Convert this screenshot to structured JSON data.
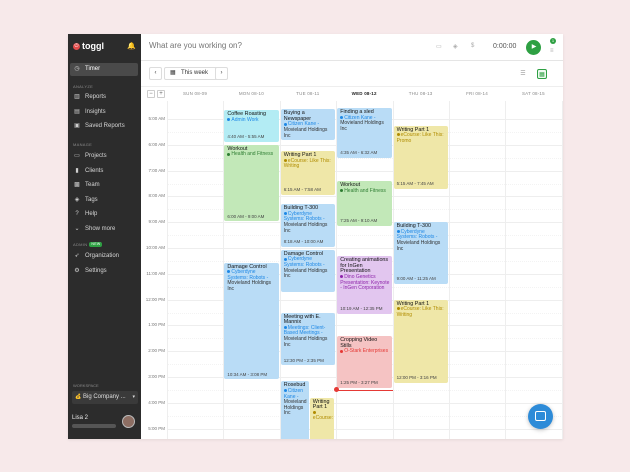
{
  "app": {
    "logo_text": "toggl",
    "logo_mark": "⏻"
  },
  "sidebar": {
    "timer_label": "Timer",
    "analyze_label": "ANALYZE",
    "analyze_items": [
      {
        "label": "Reports",
        "icon": "reports-icon"
      },
      {
        "label": "Insights",
        "icon": "insights-icon"
      },
      {
        "label": "Saved Reports",
        "icon": "saved-reports-icon"
      }
    ],
    "manage_label": "MANAGE",
    "manage_items": [
      {
        "label": "Projects",
        "icon": "projects-icon"
      },
      {
        "label": "Clients",
        "icon": "clients-icon"
      },
      {
        "label": "Team",
        "icon": "team-icon"
      },
      {
        "label": "Tags",
        "icon": "tags-icon"
      },
      {
        "label": "Help",
        "icon": "help-icon"
      },
      {
        "label": "Show more",
        "icon": "chevron-down-icon"
      }
    ],
    "admin_label": "ADMIN",
    "new_badge": "NEW",
    "admin_items": [
      {
        "label": "Organization",
        "icon": "rocket-icon"
      },
      {
        "label": "Settings",
        "icon": "gear-icon"
      }
    ],
    "workspace_label": "WORKSPACE",
    "workspace_name": "Big Company ...",
    "user_name": "Lisa 2"
  },
  "topbar": {
    "placeholder": "What are you working on?",
    "timer_value": "0:00:00",
    "notification_count": "1"
  },
  "toolbar": {
    "week_label": "This week",
    "prev": "‹",
    "next": "›"
  },
  "calendar": {
    "zoom_out": "−",
    "zoom_in": "+",
    "days": [
      "SUN 08-09",
      "MON 08-10",
      "TUE 08-11",
      "WED 08-12",
      "THU 08-13",
      "FRI 08-14",
      "SAT 08-15"
    ],
    "today_index": 3,
    "hours": [
      "5:00 AM",
      "6:00 AM",
      "7:00 AM",
      "8:00 AM",
      "9:00 AM",
      "10:00 AM",
      "11:00 AM",
      "12:00 PM",
      "1:00 PM",
      "2:00 PM",
      "3:00 PM",
      "4:00 PM",
      "5:00 PM"
    ],
    "now_time": "3:30 PM",
    "events": [
      {
        "day": 1,
        "start": "4:40",
        "end": "5:55",
        "title": "Coffee Roasting",
        "project": "Admin Work",
        "project_color": "#1e88e5",
        "client": "",
        "time": "4:40 AM - 5:55 AM",
        "bg": "#b3ecf4"
      },
      {
        "day": 1,
        "start": "6:00",
        "end": "9:00",
        "title": "Workout",
        "project": "Health and Fitness",
        "project_color": "#2e7d32",
        "client": "",
        "time": "6:00 AM - 9:00 AM",
        "bg": "#c2e8b8"
      },
      {
        "day": 1,
        "start": "10:34",
        "end": "15:08",
        "title": "Damage Control",
        "project": "Cyberdyne Systems: Robots -",
        "project_color": "#1e88e5",
        "client": "Movieland Holdings Inc",
        "time": "10:34 AM - 3:08 PM",
        "bg": "#b9dcf6"
      },
      {
        "day": 2,
        "start": "4:37",
        "end": "5:50",
        "title": "Buying a Newspaper",
        "project": "Citizen Kane -",
        "project_color": "#1e88e5",
        "client": "Movieland Holdings Inc",
        "time": "",
        "bg": "#b9dcf6"
      },
      {
        "day": 2,
        "start": "6:15",
        "end": "7:58",
        "title": "Writing Part 1",
        "project": "eCourse: Like This: Writing",
        "project_color": "#b08c00",
        "client": "",
        "time": "6:15 AM - 7:58 AM",
        "bg": "#efe7a8"
      },
      {
        "day": 2,
        "start": "8:18",
        "end": "10:00",
        "title": "Building T-300",
        "project": "Cyberdyne Systems: Robots -",
        "project_color": "#1e88e5",
        "client": "Movieland Holdings Inc",
        "time": "8:18 AM - 10:00 AM",
        "bg": "#b9dcf6"
      },
      {
        "day": 2,
        "start": "10:04",
        "end": "11:45",
        "title": "Damage Control",
        "project": "Cyberdyne Systems: Robots -",
        "project_color": "#1e88e5",
        "client": "Movieland Holdings Inc",
        "time": "",
        "bg": "#b9dcf6"
      },
      {
        "day": 2,
        "start": "12:30",
        "end": "14:35",
        "title": "Meeting with E. Mannix",
        "project": "Meetings: Client-Based Meetings -",
        "project_color": "#1e88e5",
        "client": "Movieland Holdings Inc",
        "time": "12:30 PM - 2:35 PM",
        "bg": "#b9dcf6"
      },
      {
        "day": 2,
        "start": "15:10",
        "end": "17:30",
        "title": "Rosebud",
        "project": "Citizen Kane -",
        "project_color": "#1e88e5",
        "client": "Movieland Holdings Inc",
        "time": "",
        "bg": "#b9dcf6",
        "narrow": true
      },
      {
        "day": 2,
        "start": "15:48",
        "end": "17:30",
        "title": "Writing Part 1",
        "project": "eCourse:",
        "project_color": "#b08c00",
        "client": "",
        "time": "",
        "bg": "#efe7a8",
        "offset": true
      },
      {
        "day": 3,
        "start": "4:35",
        "end": "6:32",
        "title": "Finding a sled",
        "project": "Citizen Kane -",
        "project_color": "#1e88e5",
        "client": "Movieland Holdings Inc",
        "time": "4:35 AM - 6:32 AM",
        "bg": "#b9dcf6"
      },
      {
        "day": 3,
        "start": "7:25",
        "end": "9:10",
        "title": "Workout",
        "project": "Health and Fitness",
        "project_color": "#2e7d32",
        "client": "",
        "time": "7:25 AM - 9:10 AM",
        "bg": "#c2e8b8"
      },
      {
        "day": 3,
        "start": "10:19",
        "end": "12:35",
        "title": "Creating animations for InGen Presentation",
        "project": "Dino Genetics Presentation: Keynote - InGen Corporation",
        "project_color": "#8e24aa",
        "client": "",
        "time": "10:19 AM - 12:35 PM",
        "bg": "#e2c6ef"
      },
      {
        "day": 3,
        "start": "13:25",
        "end": "15:27",
        "title": "Cropping Video Stills",
        "project": "O-Stark Enterprises",
        "project_color": "#e53935",
        "client": "",
        "time": "1:25 PM - 3:27 PM",
        "bg": "#f5c3c3"
      },
      {
        "day": 4,
        "start": "5:15",
        "end": "7:45",
        "title": "Writing Part 1",
        "project": "eCourse: Like This: Promo",
        "project_color": "#b08c00",
        "client": "",
        "time": "5:15 AM - 7:45 AM",
        "bg": "#efe7a8"
      },
      {
        "day": 4,
        "start": "9:00",
        "end": "11:25",
        "title": "Building T-300",
        "project": "Cyberdyne Systems: Robots -",
        "project_color": "#1e88e5",
        "client": "Movieland Holdings Inc",
        "time": "9:00 AM - 11:25 AM",
        "bg": "#b9dcf6"
      },
      {
        "day": 4,
        "start": "12:00",
        "end": "15:16",
        "title": "Writing Part 1",
        "project": "eCourse: Like This: Writing",
        "project_color": "#b08c00",
        "client": "",
        "time": "12:00 PM - 3:16 PM",
        "bg": "#efe7a8"
      }
    ]
  }
}
